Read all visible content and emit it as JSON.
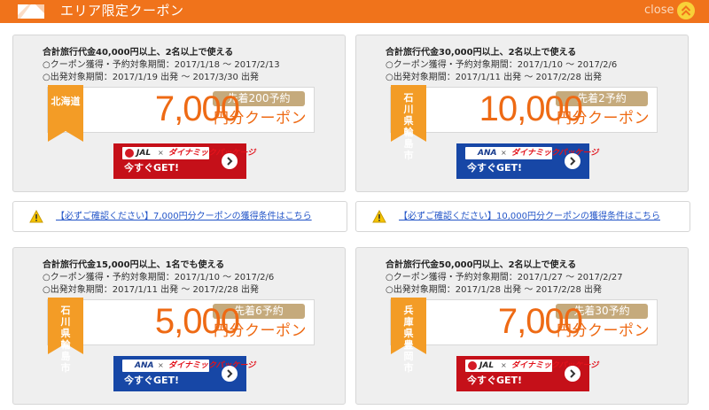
{
  "header": {
    "title": "エリア限定クーポン",
    "close_label": "close",
    "logo_icon": "coupon-ticket-icon",
    "close_icon": "chevron-up-icon"
  },
  "colors": {
    "header_bg": "#f0731b",
    "accent_orange": "#ee6a14",
    "pill_tan": "#c5aa7c",
    "jal_red": "#c51019",
    "ana_blue": "#1747a6",
    "link_blue": "#2456c8"
  },
  "coupons": [
    {
      "condition": "合計旅行代金40,000円以上、2名以上で使える",
      "acquire_period": "○クーポン獲得・予約対象期間：2017/1/18 ～ 2017/2/13",
      "departure_period": "○出発対象期間：2017/1/19 出発 ～ 2017/3/30 出発",
      "area": "北海道",
      "amount": "7,000",
      "unit": "円分クーポン",
      "limit": "先着200予約",
      "airline": "JAL",
      "pack_label": "ダイナミックパッケージ",
      "times_mark": "×",
      "button_label": "今すぐGET!",
      "notice": "【必ずご確認ください】7,000円分クーポンの獲得条件はこちら"
    },
    {
      "condition": "合計旅行代金30,000円以上、2名以上で使える",
      "acquire_period": "○クーポン獲得・予約対象期間：2017/1/10 ～ 2017/2/6",
      "departure_period": "○出発対象期間：2017/1/11 出発 ～ 2017/2/28 出発",
      "area": "石川県輪島市",
      "amount": "10,000",
      "unit": "円分クーポン",
      "limit": "先着2予約",
      "airline": "ANA",
      "pack_label": "ダイナミックパッケージ",
      "times_mark": "×",
      "button_label": "今すぐGET!",
      "notice": "【必ずご確認ください】10,000円分クーポンの獲得条件はこちら"
    },
    {
      "condition": "合計旅行代金15,000円以上、1名でも使える",
      "acquire_period": "○クーポン獲得・予約対象期間：2017/1/10 ～ 2017/2/6",
      "departure_period": "○出発対象期間：2017/1/11 出発 ～ 2017/2/28 出発",
      "area": "石川県輪島市",
      "amount": "5,000",
      "unit": "円分クーポン",
      "limit": "先着6予約",
      "airline": "ANA",
      "pack_label": "ダイナミックパッケージ",
      "times_mark": "×",
      "button_label": "今すぐGET!"
    },
    {
      "condition": "合計旅行代金50,000円以上、2名以上で使える",
      "acquire_period": "○クーポン獲得・予約対象期間：2017/1/27 ～ 2017/2/27",
      "departure_period": "○出発対象期間：2017/1/28 出発 ～ 2017/2/28 出発",
      "area": "兵庫県豊岡市",
      "amount": "7,000",
      "unit": "円分クーポン",
      "limit": "先着30予約",
      "airline": "JAL",
      "pack_label": "ダイナミックパッケージ",
      "times_mark": "×",
      "button_label": "今すぐGET!"
    }
  ]
}
